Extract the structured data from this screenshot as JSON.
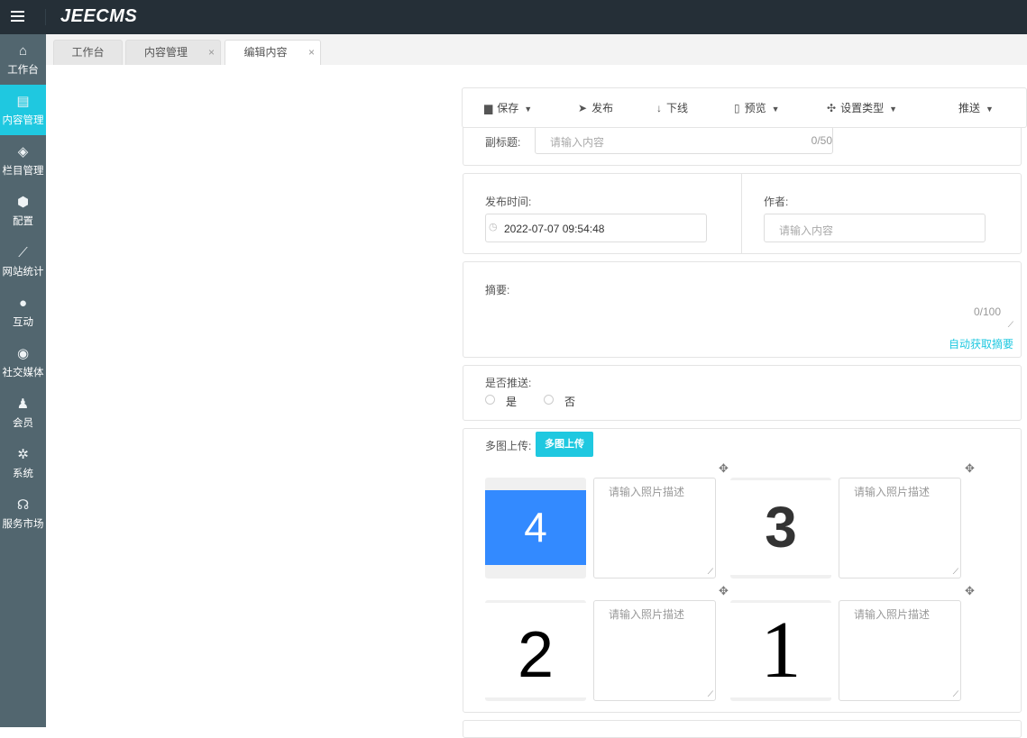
{
  "header": {
    "logo": "JEECMS"
  },
  "sidebar": {
    "items": [
      {
        "label": "工作台",
        "icon": "home-icon",
        "glyph": "⌂"
      },
      {
        "label": "内容管理",
        "icon": "document-icon",
        "glyph": "▤"
      },
      {
        "label": "栏目管理",
        "icon": "layers-icon",
        "glyph": "◈"
      },
      {
        "label": "配置",
        "icon": "cube-icon",
        "glyph": "⬢"
      },
      {
        "label": "网站统计",
        "icon": "line-chart-icon",
        "glyph": "⟋"
      },
      {
        "label": "互动",
        "icon": "chat-icon",
        "glyph": "●"
      },
      {
        "label": "社交媒体",
        "icon": "target-icon",
        "glyph": "◉"
      },
      {
        "label": "会员",
        "icon": "member-icon",
        "glyph": "♟"
      },
      {
        "label": "系统",
        "icon": "gear-icon",
        "glyph": "✲"
      },
      {
        "label": "服务市场",
        "icon": "headset-icon",
        "glyph": "☊"
      }
    ],
    "active": 1
  },
  "tabs": [
    {
      "label": "工作台"
    },
    {
      "label": "内容管理",
      "close": "×"
    },
    {
      "label": "编辑内容",
      "close": "×"
    }
  ],
  "toolbar": {
    "save": "保存",
    "publish": "发布",
    "offline": "下线",
    "preview": "预览",
    "set_type": "设置类型",
    "push": "推送"
  },
  "form": {
    "subtitle_label": "副标题:",
    "subtitle_placeholder": "请输入内容",
    "subtitle_count": "0/50",
    "publish_time_label": "发布时间:",
    "publish_time_value": "2022-07-07 09:54:48",
    "author_label": "作者:",
    "author_placeholder": "请输入内容",
    "summary_label": "摘要:",
    "summary_count": "0/100",
    "auto_summary": "自动获取摘要",
    "push_label": "是否推送:",
    "push_yes": "是",
    "push_no": "否",
    "multi_upload_label": "多图上传:",
    "multi_upload_button": "多图上传",
    "photos": [
      {
        "number": "4",
        "desc_placeholder": "请输入照片描述"
      },
      {
        "number": "3",
        "desc_placeholder": "请输入照片描述"
      },
      {
        "number": "2",
        "desc_placeholder": "请输入照片描述"
      },
      {
        "number": "1",
        "desc_placeholder": "请输入照片描述"
      }
    ]
  },
  "colors": {
    "accent": "#1fc8e0",
    "header": "#252f37",
    "sidebar": "#52666f",
    "photo4_bg": "#338aff"
  }
}
